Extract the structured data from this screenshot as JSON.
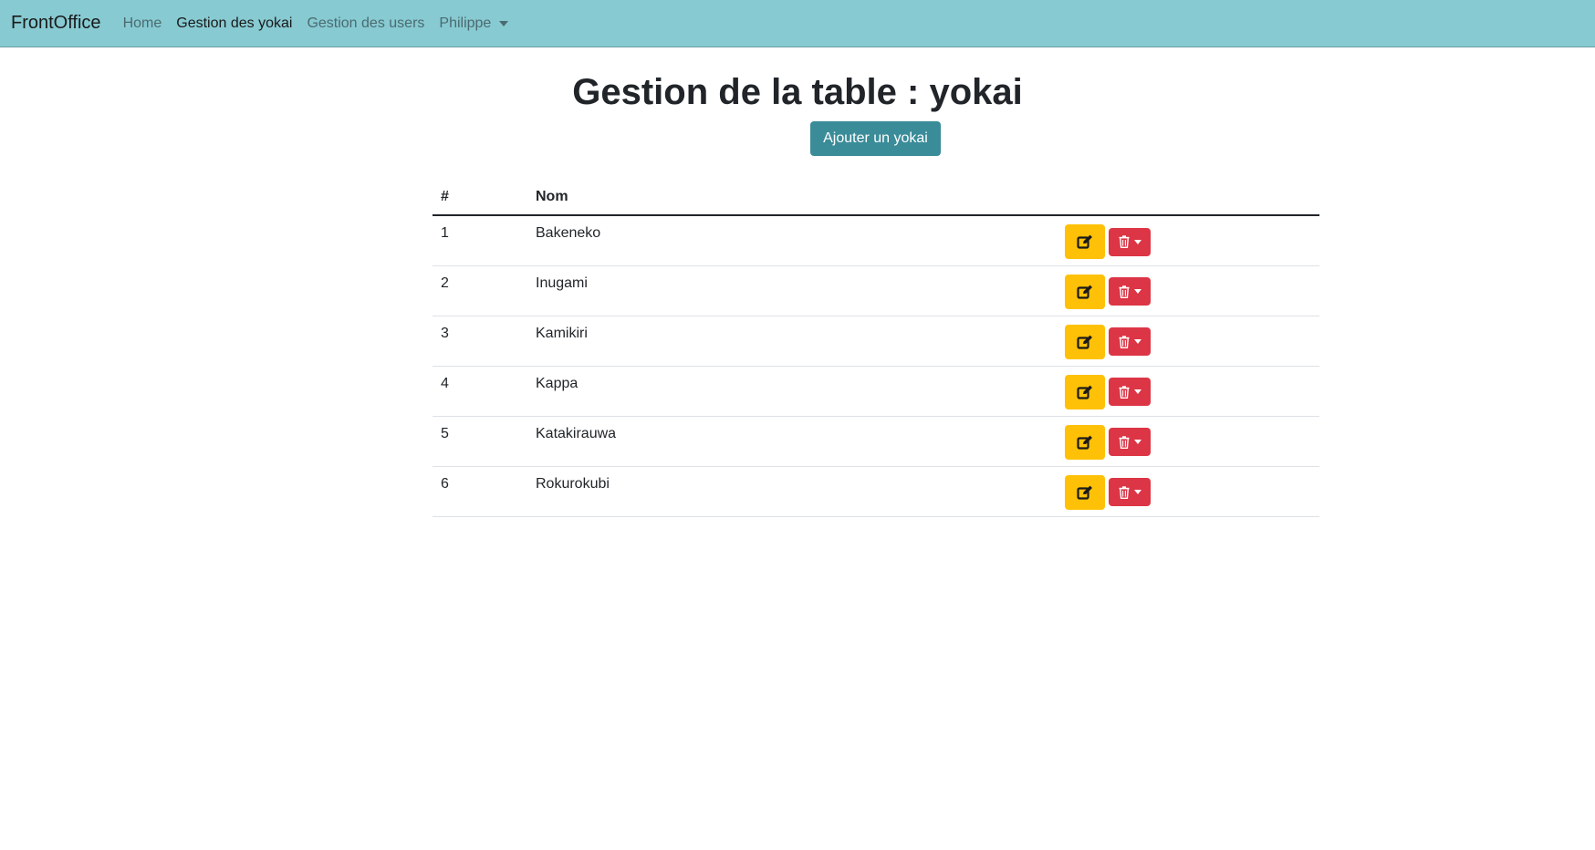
{
  "navbar": {
    "brand": "FrontOffice",
    "links": [
      {
        "label": "Home",
        "active": false
      },
      {
        "label": "Gestion des yokai",
        "active": true
      },
      {
        "label": "Gestion des users",
        "active": false
      }
    ],
    "user_menu": {
      "label": "Philippe",
      "icon": "caret-down-icon"
    }
  },
  "main": {
    "title": "Gestion de la table : yokai",
    "add_button_label": "Ajouter un yokai",
    "table": {
      "headers": [
        "#",
        "Nom",
        ""
      ],
      "rows": [
        {
          "id": "1",
          "name": "Bakeneko"
        },
        {
          "id": "2",
          "name": "Inugami"
        },
        {
          "id": "3",
          "name": "Kamikiri"
        },
        {
          "id": "4",
          "name": "Kappa"
        },
        {
          "id": "5",
          "name": "Katakirauwa"
        },
        {
          "id": "6",
          "name": "Rokurokubi"
        }
      ],
      "row_actions": {
        "edit_icon": "edit-icon",
        "delete_icon": "trash-icon"
      }
    }
  },
  "colors": {
    "navbar_bg": "#87cad2",
    "primary_button": "#3a8c99",
    "edit_button": "#ffc107",
    "delete_button": "#dc3545"
  }
}
